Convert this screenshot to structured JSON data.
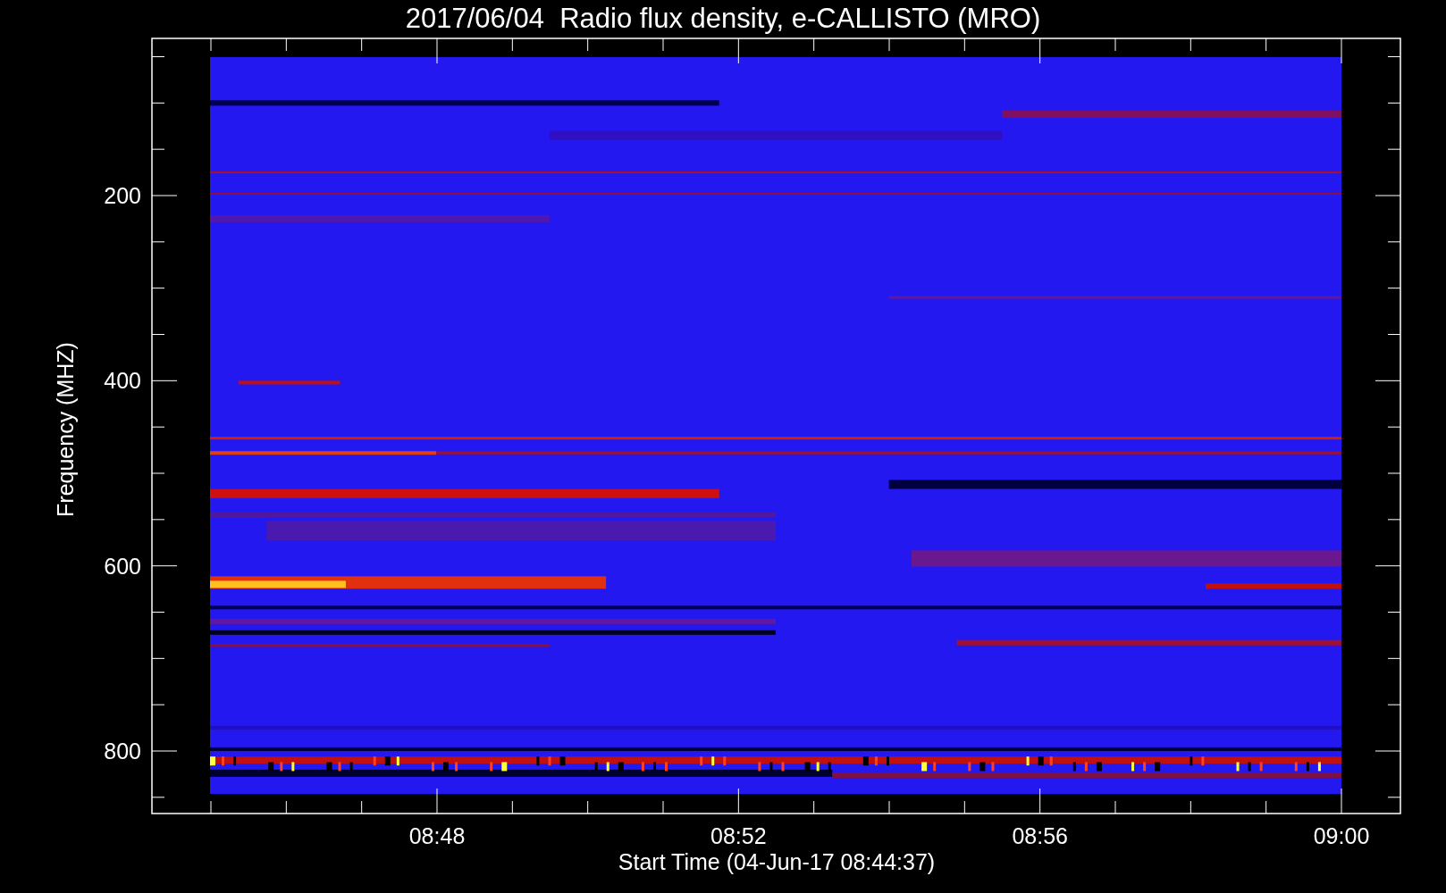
{
  "plot": {
    "title": "2017/06/04  Radio flux density, e-CALLISTO (MRO)",
    "xlabel": "Start Time (04-Jun-17 08:44:37)",
    "ylabel": "Frequency (MHZ)",
    "x_tick_labels": [
      "08:48",
      "08:52",
      "08:56",
      "09:00"
    ],
    "y_tick_labels": [
      "200",
      "400",
      "600",
      "800"
    ]
  }
}
